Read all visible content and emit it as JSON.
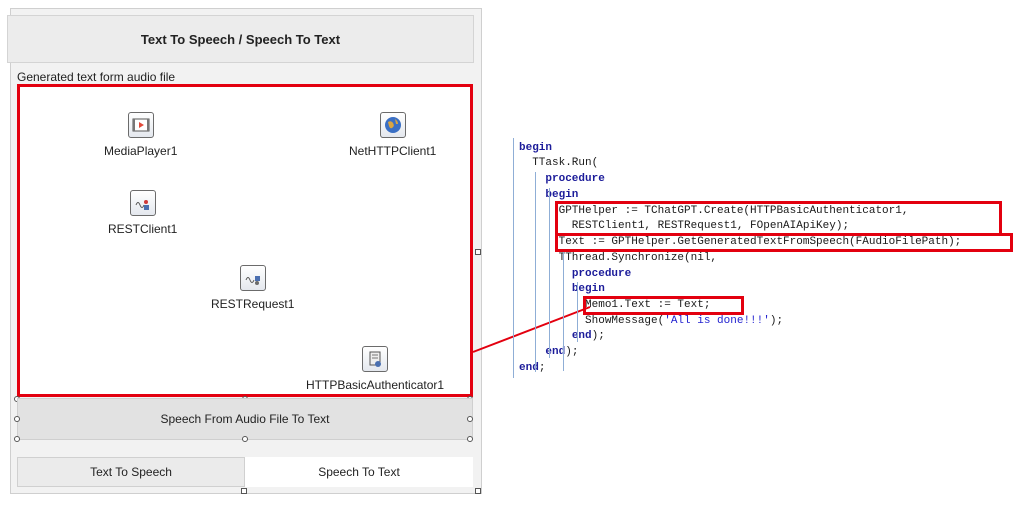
{
  "form": {
    "title": "Text To Speech / Speech To Text",
    "memo_label": "Generated text form audio file",
    "components": [
      {
        "name": "MediaPlayer1",
        "icon": "media-player-icon"
      },
      {
        "name": "NetHTTPClient1",
        "icon": "globe-icon"
      },
      {
        "name": "RESTClient1",
        "icon": "rest-client-icon"
      },
      {
        "name": "RESTRequest1",
        "icon": "rest-request-icon"
      },
      {
        "name": "HTTPBasicAuthenticator1",
        "icon": "authenticator-icon"
      }
    ],
    "audio_button_label": "Speech From Audio File To Text",
    "tabs": [
      {
        "label": "Text To Speech"
      },
      {
        "label": "Speech To Text"
      }
    ]
  },
  "code": {
    "lines": [
      [
        {
          "t": "begin",
          "c": "kw"
        }
      ],
      [
        {
          "t": "  TTask.Run(",
          "c": ""
        }
      ],
      [
        {
          "t": "    ",
          "c": ""
        },
        {
          "t": "procedure",
          "c": "kw"
        }
      ],
      [
        {
          "t": "    ",
          "c": ""
        },
        {
          "t": "begin",
          "c": "kw"
        }
      ],
      [
        {
          "t": "      GPTHelper := TChatGPT.Create(HTTPBasicAuthenticator1,",
          "c": ""
        }
      ],
      [
        {
          "t": "        RESTClient1, RESTRequest1, FOpenAIApiKey);",
          "c": ""
        }
      ],
      [
        {
          "t": "      Text := GPTHelper.GetGeneratedTextFromSpeech(FAudioFilePath);",
          "c": ""
        }
      ],
      [
        {
          "t": "      TThread.Synchronize(nil,",
          "c": ""
        }
      ],
      [
        {
          "t": "        ",
          "c": ""
        },
        {
          "t": "procedure",
          "c": "kw"
        }
      ],
      [
        {
          "t": "        ",
          "c": ""
        },
        {
          "t": "begin",
          "c": "kw"
        }
      ],
      [
        {
          "t": "          Memo1.Text := Text;",
          "c": ""
        }
      ],
      [
        {
          "t": "          ShowMessage(",
          "c": ""
        },
        {
          "t": "'All is done!!!'",
          "c": "str"
        },
        {
          "t": ");",
          "c": ""
        }
      ],
      [
        {
          "t": "        ",
          "c": ""
        },
        {
          "t": "end",
          "c": "kw"
        },
        {
          "t": ");",
          "c": ""
        }
      ],
      [
        {
          "t": "    ",
          "c": ""
        },
        {
          "t": "end",
          "c": "kw"
        },
        {
          "t": ");",
          "c": ""
        }
      ],
      [
        {
          "t": "end",
          "c": "kw"
        },
        {
          "t": ";",
          "c": ""
        }
      ]
    ]
  },
  "colors": {
    "highlight": "#e3000f",
    "keyword": "#1c1c9a",
    "string": "#1f1fcf"
  }
}
